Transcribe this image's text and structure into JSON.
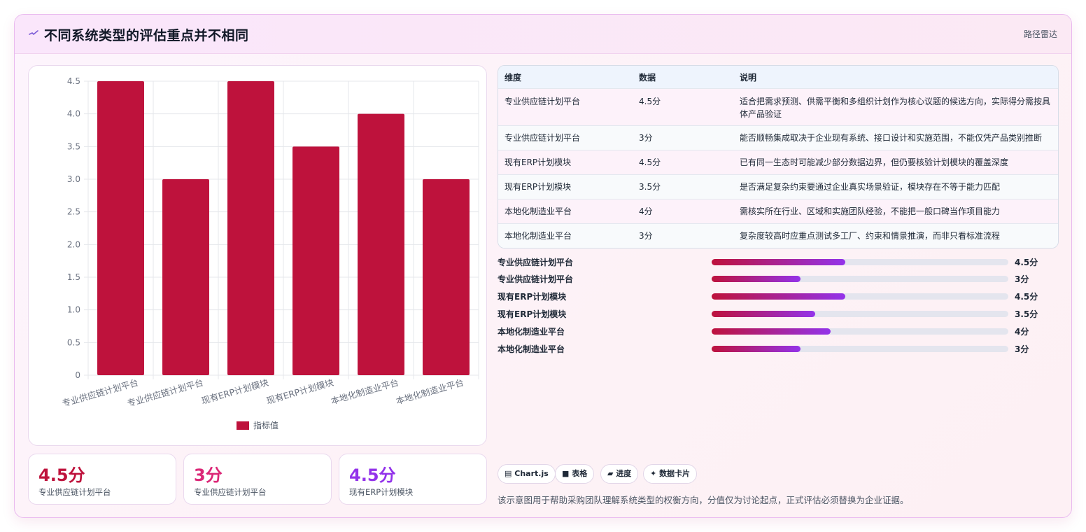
{
  "header": {
    "title": "不同系统类型的评估重点并不相同",
    "link": "路径雷达"
  },
  "colors": {
    "bar": "#be123c",
    "stat1": "#be123c",
    "stat2": "#db2777",
    "stat3": "#9333ea"
  },
  "chart_data": {
    "type": "bar",
    "categories": [
      "专业供应链计划平台",
      "专业供应链计划平台",
      "现有ERP计划模块",
      "现有ERP计划模块",
      "本地化制造业平台",
      "本地化制造业平台"
    ],
    "series": [
      {
        "name": "指标值",
        "values": [
          4.5,
          3,
          4.5,
          3.5,
          4,
          3
        ]
      }
    ],
    "ylim": [
      0,
      4.5
    ],
    "yticks": [
      "0",
      "0.5",
      "1.0",
      "1.5",
      "2.0",
      "2.5",
      "3.0",
      "3.5",
      "4.0",
      "4.5"
    ],
    "grid": true,
    "legend": "bottom"
  },
  "stats": [
    {
      "value": "4.5分",
      "label": "专业供应链计划平台"
    },
    {
      "value": "3分",
      "label": "专业供应链计划平台"
    },
    {
      "value": "4.5分",
      "label": "现有ERP计划模块"
    }
  ],
  "table": {
    "headers": [
      "维度",
      "数据",
      "说明"
    ],
    "rows": [
      [
        "专业供应链计划平台",
        "4.5分",
        "适合把需求预测、供需平衡和多组织计划作为核心议题的候选方向，实际得分需按具体产品验证"
      ],
      [
        "专业供应链计划平台",
        "3分",
        "能否顺畅集成取决于企业现有系统、接口设计和实施范围，不能仅凭产品类别推断"
      ],
      [
        "现有ERP计划模块",
        "4.5分",
        "已有同一生态时可能减少部分数据边界，但仍要核验计划模块的覆盖深度"
      ],
      [
        "现有ERP计划模块",
        "3.5分",
        "是否满足复杂约束要通过企业真实场景验证，模块存在不等于能力匹配"
      ],
      [
        "本地化制造业平台",
        "4分",
        "需核实所在行业、区域和实施团队经验，不能把一般口碑当作项目能力"
      ],
      [
        "本地化制造业平台",
        "3分",
        "复杂度较高时应重点测试多工厂、约束和情景推演，而非只看标准流程"
      ]
    ]
  },
  "progress": [
    {
      "label": "专业供应链计划平台",
      "value": "4.5分",
      "fraction": 0.45
    },
    {
      "label": "专业供应链计划平台",
      "value": "3分",
      "fraction": 0.3
    },
    {
      "label": "现有ERP计划模块",
      "value": "4.5分",
      "fraction": 0.45
    },
    {
      "label": "现有ERP计划模块",
      "value": "3.5分",
      "fraction": 0.35
    },
    {
      "label": "本地化制造业平台",
      "value": "4分",
      "fraction": 0.4
    },
    {
      "label": "本地化制造业平台",
      "value": "3分",
      "fraction": 0.3
    }
  ],
  "chips": [
    "Chart.js",
    "表格",
    "进度",
    "数据卡片"
  ],
  "footnote": "该示意图用于帮助采购团队理解系统类型的权衡方向，分值仅为讨论起点，正式评估必须替换为企业证据。"
}
